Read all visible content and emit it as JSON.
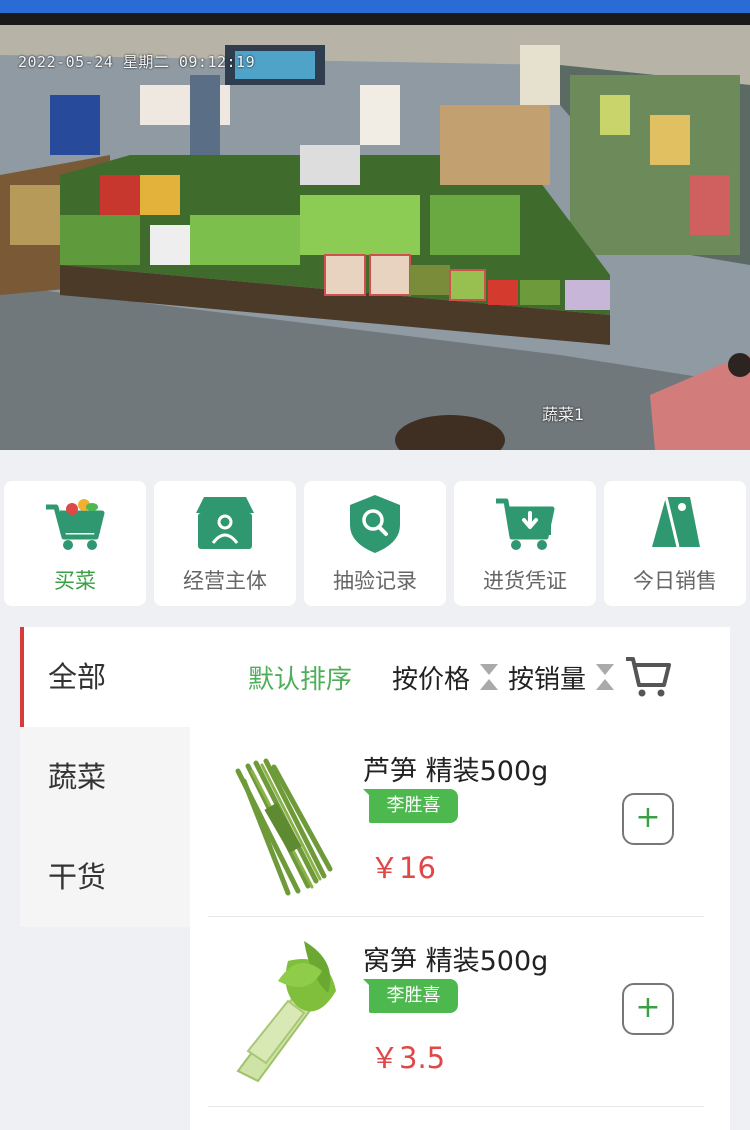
{
  "video": {
    "timestamp": "2022-05-24 星期二 09:12:19",
    "camera_label": "蔬菜1"
  },
  "quick_menu": [
    {
      "label": "买菜",
      "icon": "shopping-cart-vegetables-icon",
      "active": true
    },
    {
      "label": "经营主体",
      "icon": "storefront-person-icon",
      "active": false
    },
    {
      "label": "抽验记录",
      "icon": "shield-search-icon",
      "active": false
    },
    {
      "label": "进货凭证",
      "icon": "cart-download-icon",
      "active": false
    },
    {
      "label": "今日销售",
      "icon": "price-tag-icon",
      "active": false
    }
  ],
  "categories": [
    {
      "label": "全部",
      "active": true
    },
    {
      "label": "蔬菜",
      "active": false
    },
    {
      "label": "干货",
      "active": false
    }
  ],
  "sort": {
    "default_label": "默认排序",
    "price_label": "按价格",
    "sales_label": "按销量"
  },
  "products": [
    {
      "name": "芦笋 精装500g",
      "vendor": "李胜喜",
      "price": "￥16",
      "add_label": "+"
    },
    {
      "name": "窝笋 精装500g",
      "vendor": "李胜喜",
      "price": "￥3.5",
      "add_label": "+"
    }
  ],
  "colors": {
    "accent_green": "#3aa044",
    "icon_green": "#2f9870",
    "price_red": "#e04848",
    "category_marker": "#d93a3a",
    "top_bar_blue": "#2a6cd6"
  }
}
